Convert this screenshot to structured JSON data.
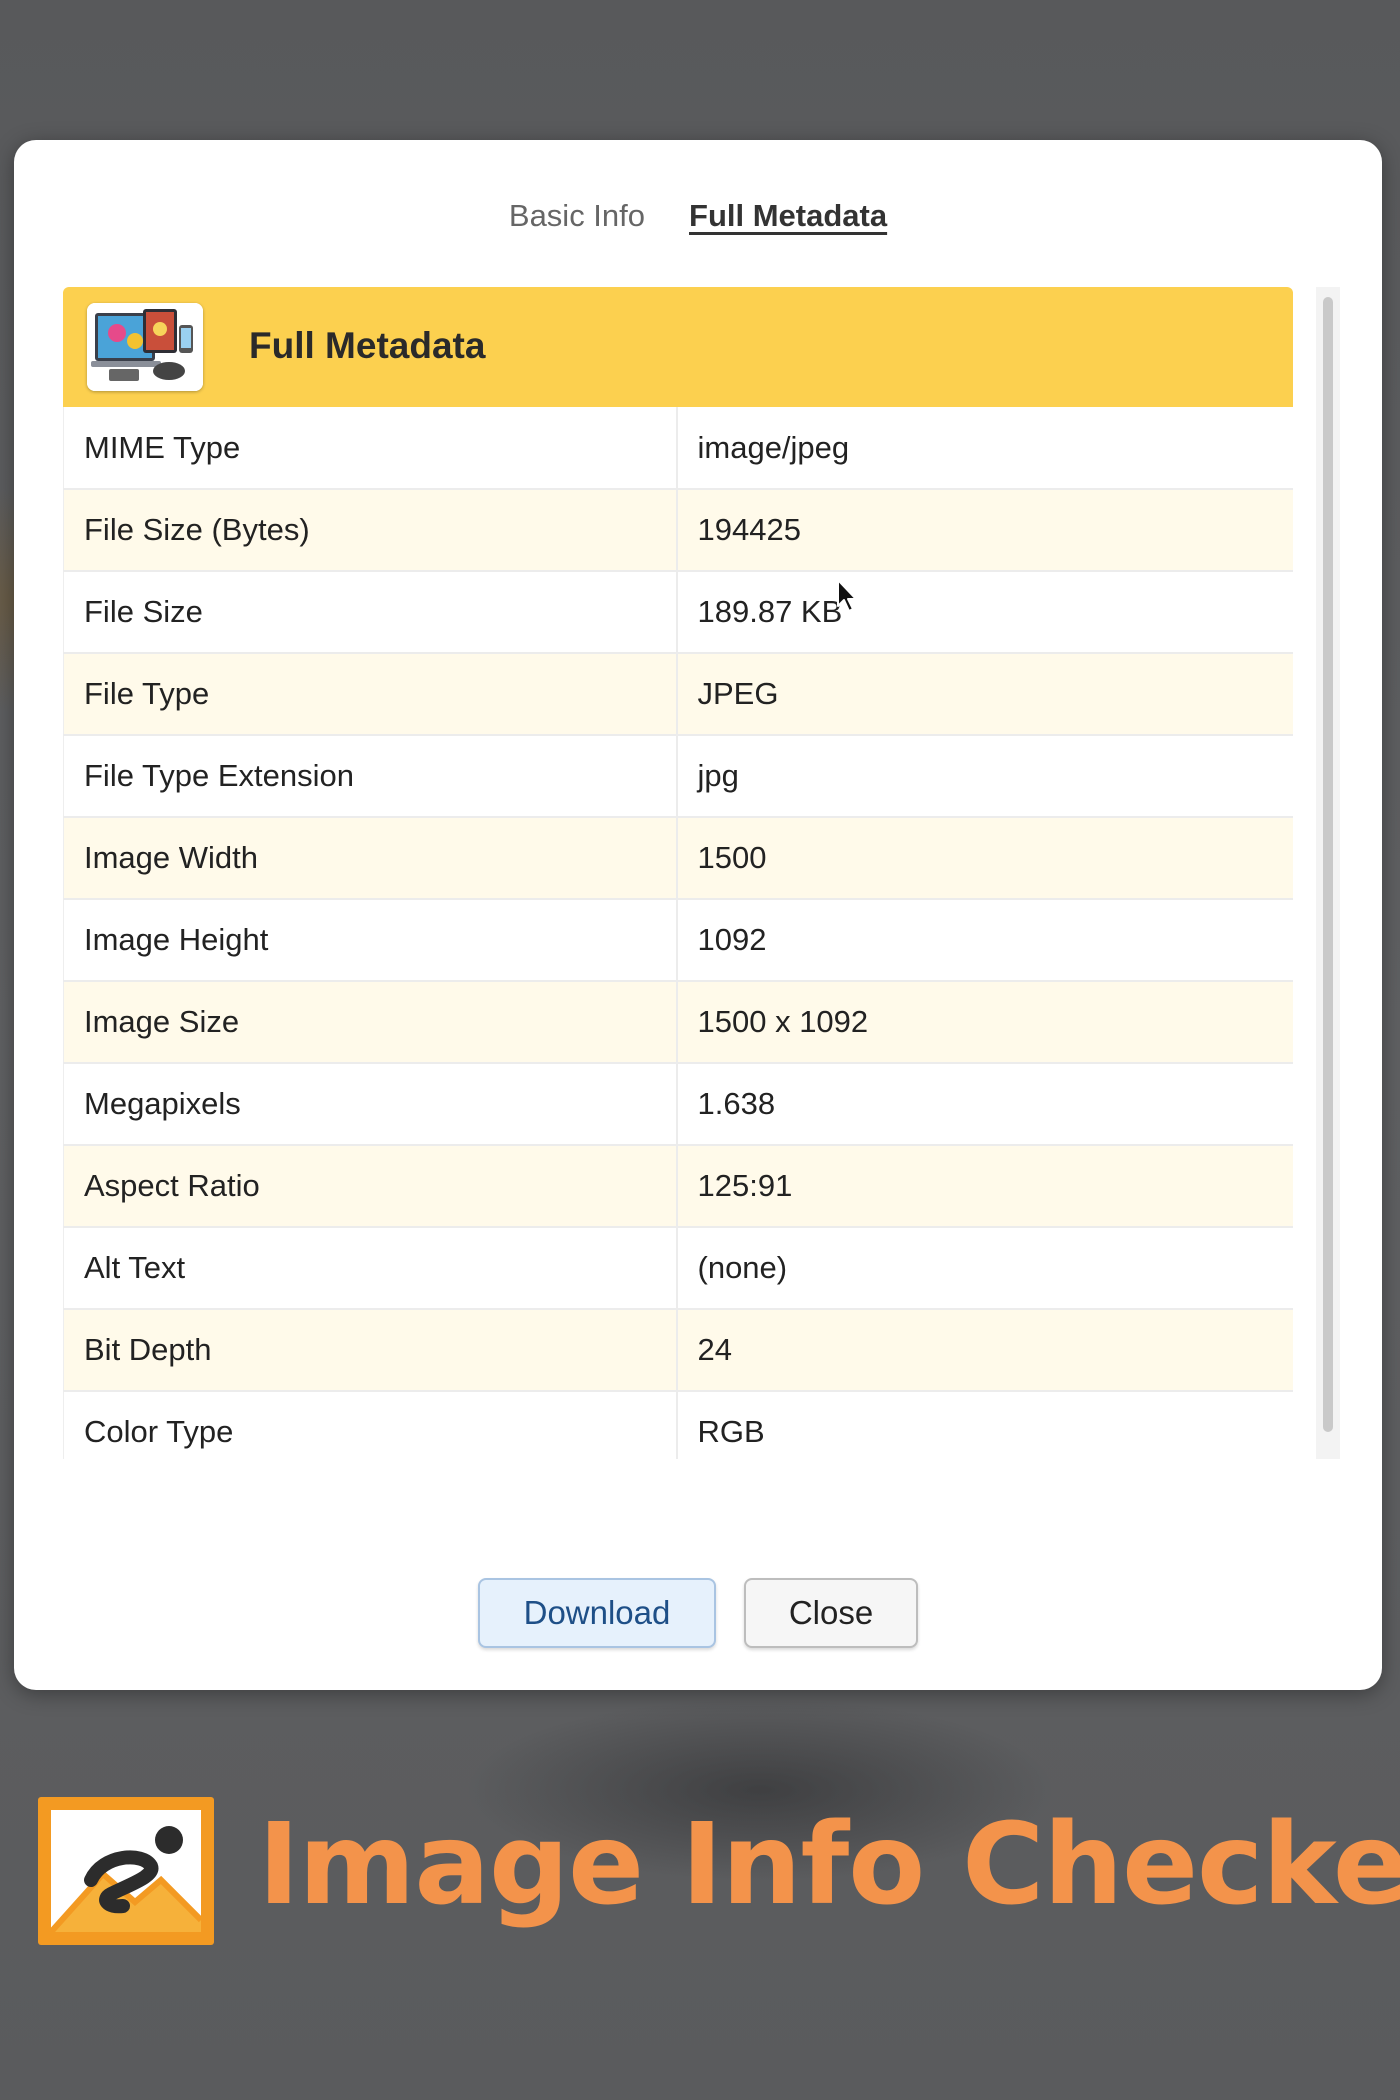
{
  "tabs": [
    {
      "label": "Basic Info",
      "active": false
    },
    {
      "label": "Full Metadata",
      "active": true
    }
  ],
  "panel": {
    "title": "Full Metadata",
    "thumbnail_icon": "device-collage-thumbnail",
    "header_color": "#fcd04f"
  },
  "rows": [
    {
      "key": "MIME Type",
      "value": "image/jpeg"
    },
    {
      "key": "File Size (Bytes)",
      "value": "194425"
    },
    {
      "key": "File Size",
      "value": "189.87 KB"
    },
    {
      "key": "File Type",
      "value": "JPEG"
    },
    {
      "key": "File Type Extension",
      "value": "jpg"
    },
    {
      "key": "Image Width",
      "value": "1500"
    },
    {
      "key": "Image Height",
      "value": "1092"
    },
    {
      "key": "Image Size",
      "value": "1500 x 1092"
    },
    {
      "key": "Megapixels",
      "value": "1.638"
    },
    {
      "key": "Aspect Ratio",
      "value": "125:91"
    },
    {
      "key": "Alt Text",
      "value": "(none)"
    },
    {
      "key": "Bit Depth",
      "value": "24"
    },
    {
      "key": "Color Type",
      "value": "RGB"
    },
    {
      "key": "",
      "value": ""
    }
  ],
  "buttons": {
    "download": "Download",
    "close": "Close"
  },
  "brand": {
    "name": "Image Info Checker",
    "logo_icon": "image-info-checker-logo",
    "color": "#f3934b"
  }
}
